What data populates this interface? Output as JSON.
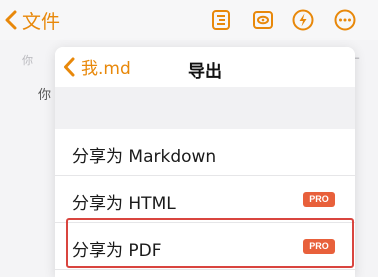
{
  "topbar": {
    "back_label": "文件",
    "icons": [
      "outline-icon",
      "preview-eye-icon",
      "lightning-icon",
      "more-icon"
    ],
    "accent_color": "#e8880a"
  },
  "document": {
    "toolbar_hint": "你",
    "toolbar_plus": "+",
    "body_text": "你"
  },
  "popup": {
    "back_label": "我.md",
    "title": "导出",
    "items": [
      {
        "label": "分享为 Markdown",
        "badge": ""
      },
      {
        "label": "分享为 HTML",
        "badge": "PRO"
      },
      {
        "label": "分享为 PDF",
        "badge": "PRO"
      }
    ],
    "badge_color": "#e8603b",
    "highlight_color": "#d9453f"
  }
}
